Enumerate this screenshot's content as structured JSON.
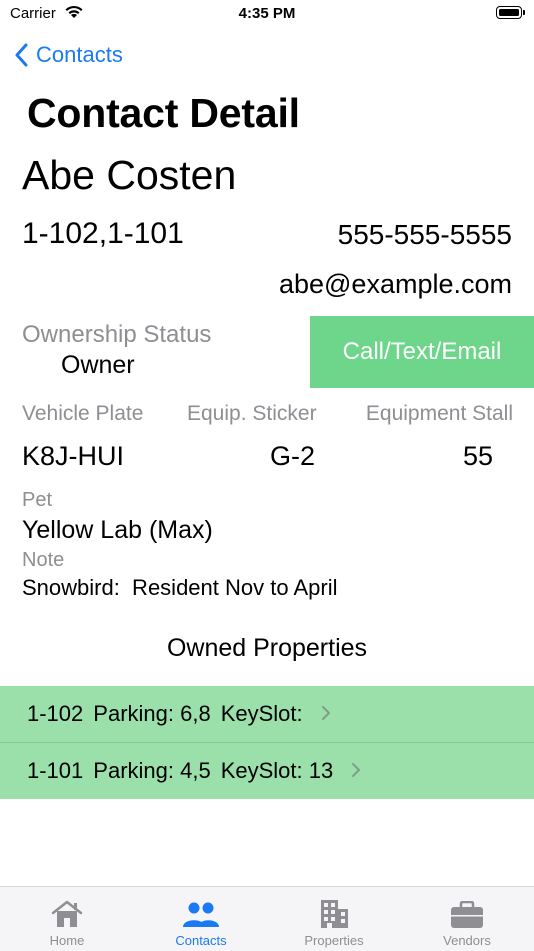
{
  "status_bar": {
    "carrier": "Carrier",
    "time": "4:35 PM"
  },
  "nav": {
    "back_label": "Contacts"
  },
  "page_title": "Contact Detail",
  "contact": {
    "name": "Abe Costen",
    "units": "1-102,1-101",
    "phone": "555-555-5555",
    "email": "abe@example.com"
  },
  "ownership": {
    "label": "Ownership Status",
    "value": "Owner"
  },
  "action_button": "Call/Text/Email",
  "vehicle": {
    "plate_label": "Vehicle Plate",
    "sticker_label": "Equip. Sticker",
    "stall_label": "Equipment Stall",
    "plate": "K8J-HUI",
    "sticker": "G-2",
    "stall": "55"
  },
  "pet": {
    "label": "Pet",
    "value": "Yellow Lab (Max)"
  },
  "note": {
    "label": "Note",
    "value": "Snowbird:  Resident Nov to April"
  },
  "owned_properties": {
    "title": "Owned Properties",
    "rows": [
      {
        "unit": "1-102",
        "parking": "Parking: 6,8",
        "keyslot": "KeySlot:"
      },
      {
        "unit": "1-101",
        "parking": "Parking: 4,5",
        "keyslot": "KeySlot: 13"
      }
    ]
  },
  "tabs": [
    {
      "label": "Home",
      "icon": "house-icon",
      "active": false
    },
    {
      "label": "Contacts",
      "icon": "people-icon",
      "active": true
    },
    {
      "label": "Properties",
      "icon": "building-icon",
      "active": false
    },
    {
      "label": "Vendors",
      "icon": "briefcase-icon",
      "active": false
    }
  ],
  "colors": {
    "accent": "#1a7af5",
    "action_green": "#6dd68a",
    "row_green": "#9be0ab",
    "secondary_gray": "#8e8e93"
  }
}
